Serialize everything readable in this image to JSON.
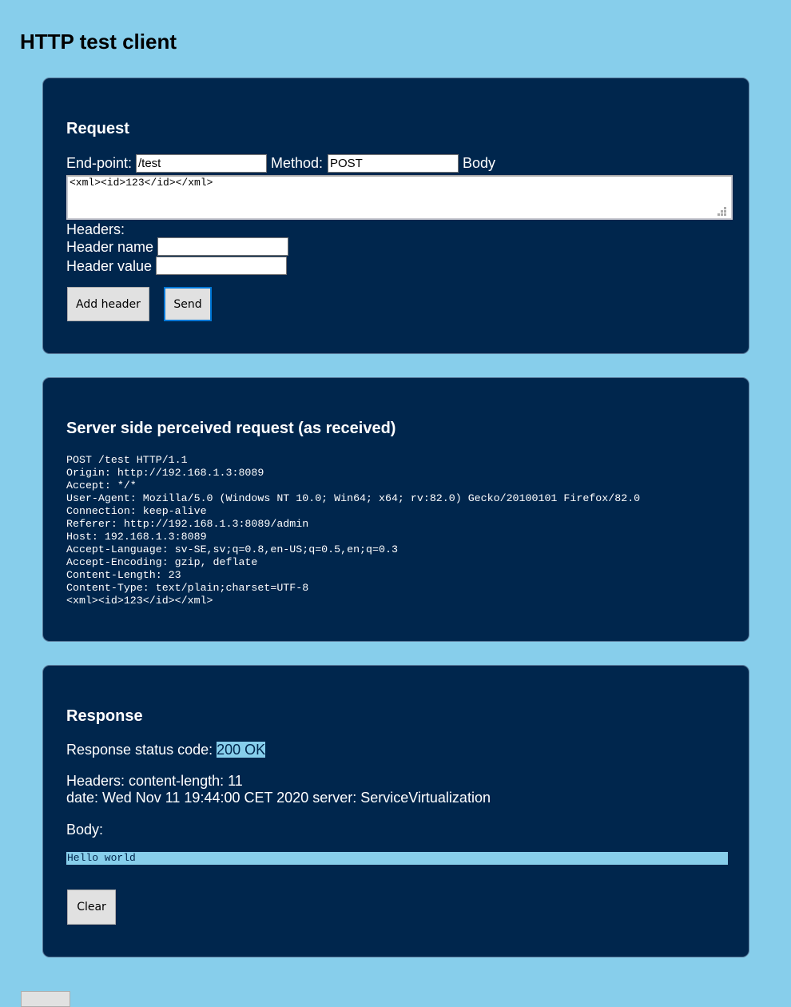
{
  "page": {
    "title": "HTTP test client"
  },
  "request": {
    "heading": "Request",
    "endpoint_label": "End-point:",
    "endpoint_value": "/test",
    "method_label": "Method:",
    "method_value": "POST",
    "body_label": "Body",
    "body_value": "<xml><id>123</id></xml>",
    "headers_label": "Headers:",
    "header_name_label": "Header name",
    "header_name_value": "",
    "header_value_label": "Header value",
    "header_value_value": "",
    "add_header_label": "Add header",
    "send_label": "Send"
  },
  "server": {
    "heading": "Server side perceived request (as received)",
    "lines": [
      "POST /test HTTP/1.1",
      "Origin: http://192.168.1.3:8089",
      "Accept: */*",
      "User-Agent: Mozilla/5.0 (Windows NT 10.0; Win64; x64; rv:82.0) Gecko/20100101 Firefox/82.0",
      "Connection: keep-alive",
      "Referer: http://192.168.1.3:8089/admin",
      "Host: 192.168.1.3:8089",
      "Accept-Language: sv-SE,sv;q=0.8,en-US;q=0.5,en;q=0.3",
      "Accept-Encoding: gzip, deflate",
      "Content-Length: 23",
      "Content-Type: text/plain;charset=UTF-8",
      "<xml><id>123</id></xml>"
    ]
  },
  "response": {
    "heading": "Response",
    "status_label": "Response status code:",
    "status_value": "200 OK",
    "headers_line1": "Headers: content-length: 11",
    "headers_line2": "date: Wed Nov 11 19:44:00 CET 2020 server: ServiceVirtualization",
    "body_label": "Body:",
    "body_value": "Hello world",
    "clear_label": "Clear"
  },
  "colors": {
    "page_background": "#87ceeb",
    "panel_background": "#00264d",
    "button_background": "#e1e1e1",
    "focus_ring": "#0078d7"
  }
}
